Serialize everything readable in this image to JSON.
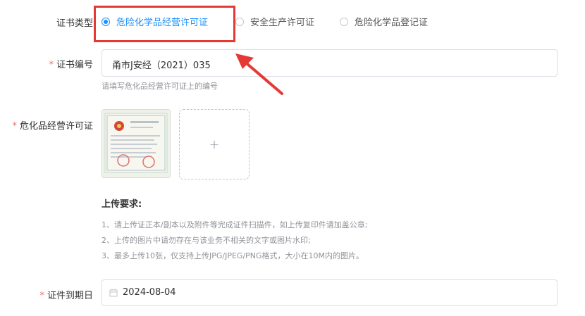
{
  "cert_type": {
    "label": "证书类型",
    "options": [
      {
        "label": "危险化学品经营许可证",
        "checked": true
      },
      {
        "label": "安全生产许可证",
        "checked": false
      },
      {
        "label": "危险化学品登记证",
        "checked": false
      }
    ]
  },
  "cert_number": {
    "required_mark": "*",
    "label": "证书编号",
    "value": "甬市J安经（2021）035",
    "hint": "请填写危化品经营许可证上的编号"
  },
  "license_upload": {
    "required_mark": "*",
    "label": "危化品经营许可证",
    "add_symbol": "+"
  },
  "upload_requirements": {
    "title": "上传要求:",
    "lines": [
      "1、请上传证正本/副本以及附件等完成证件扫描件，如上传复印件请加盖公章;",
      "2、上传的图片中请勿存在与该业务不相关的文字或图片水印;",
      "3、最多上传10张，仅支持上传JPG/JPEG/PNG格式，大小在10M内的图片。"
    ]
  },
  "expiry": {
    "required_mark": "*",
    "label": "证件到期日",
    "value": "2024-08-04",
    "icon": "calendar-icon"
  },
  "colors": {
    "primary": "#1890ff",
    "required": "#f56c6c",
    "annotation": "#e53935"
  }
}
